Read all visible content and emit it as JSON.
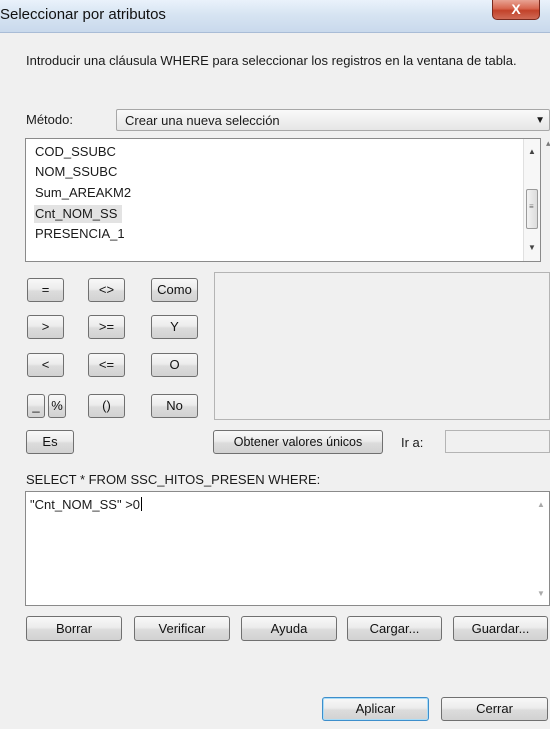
{
  "window": {
    "title": "Seleccionar por atributos",
    "close_label": "X"
  },
  "intro": "Introducir una cláusula WHERE para seleccionar los registros en la ventana de tabla.",
  "method": {
    "label": "Método:",
    "value": "Crear una nueva selección",
    "arrow": "▼"
  },
  "fields": {
    "items": [
      "COD_SSUBC",
      "NOM_SSUBC",
      "Sum_AREAKM2",
      "Cnt_NOM_SS",
      "PRESENCIA_1"
    ],
    "selected": "Cnt_NOM_SS",
    "scroll_up": "▲",
    "scroll_down": "▼",
    "thumb_grip": "≡"
  },
  "operators": {
    "eq": "=",
    "neq": "<>",
    "like": "Como",
    "gt": ">",
    "gte": ">=",
    "and": "Y",
    "lt": "<",
    "lte": "<=",
    "or": "O",
    "underscore": "_",
    "percent": "%",
    "parens": "()",
    "not": "No",
    "is": "Es"
  },
  "values": {
    "unique_button": "Obtener valores únicos",
    "goto_label": "Ir a:",
    "goto_value": ""
  },
  "sql": {
    "prefix": "SELECT * FROM SSC_HITOS_PRESEN WHERE:",
    "expression": "\"Cnt_NOM_SS\" >0",
    "scroll_up": "▲",
    "scroll_down": "▼"
  },
  "actions": {
    "clear": "Borrar",
    "verify": "Verificar",
    "help": "Ayuda",
    "load": "Cargar...",
    "save": "Guardar..."
  },
  "dialog_buttons": {
    "apply": "Aplicar",
    "close": "Cerrar"
  }
}
